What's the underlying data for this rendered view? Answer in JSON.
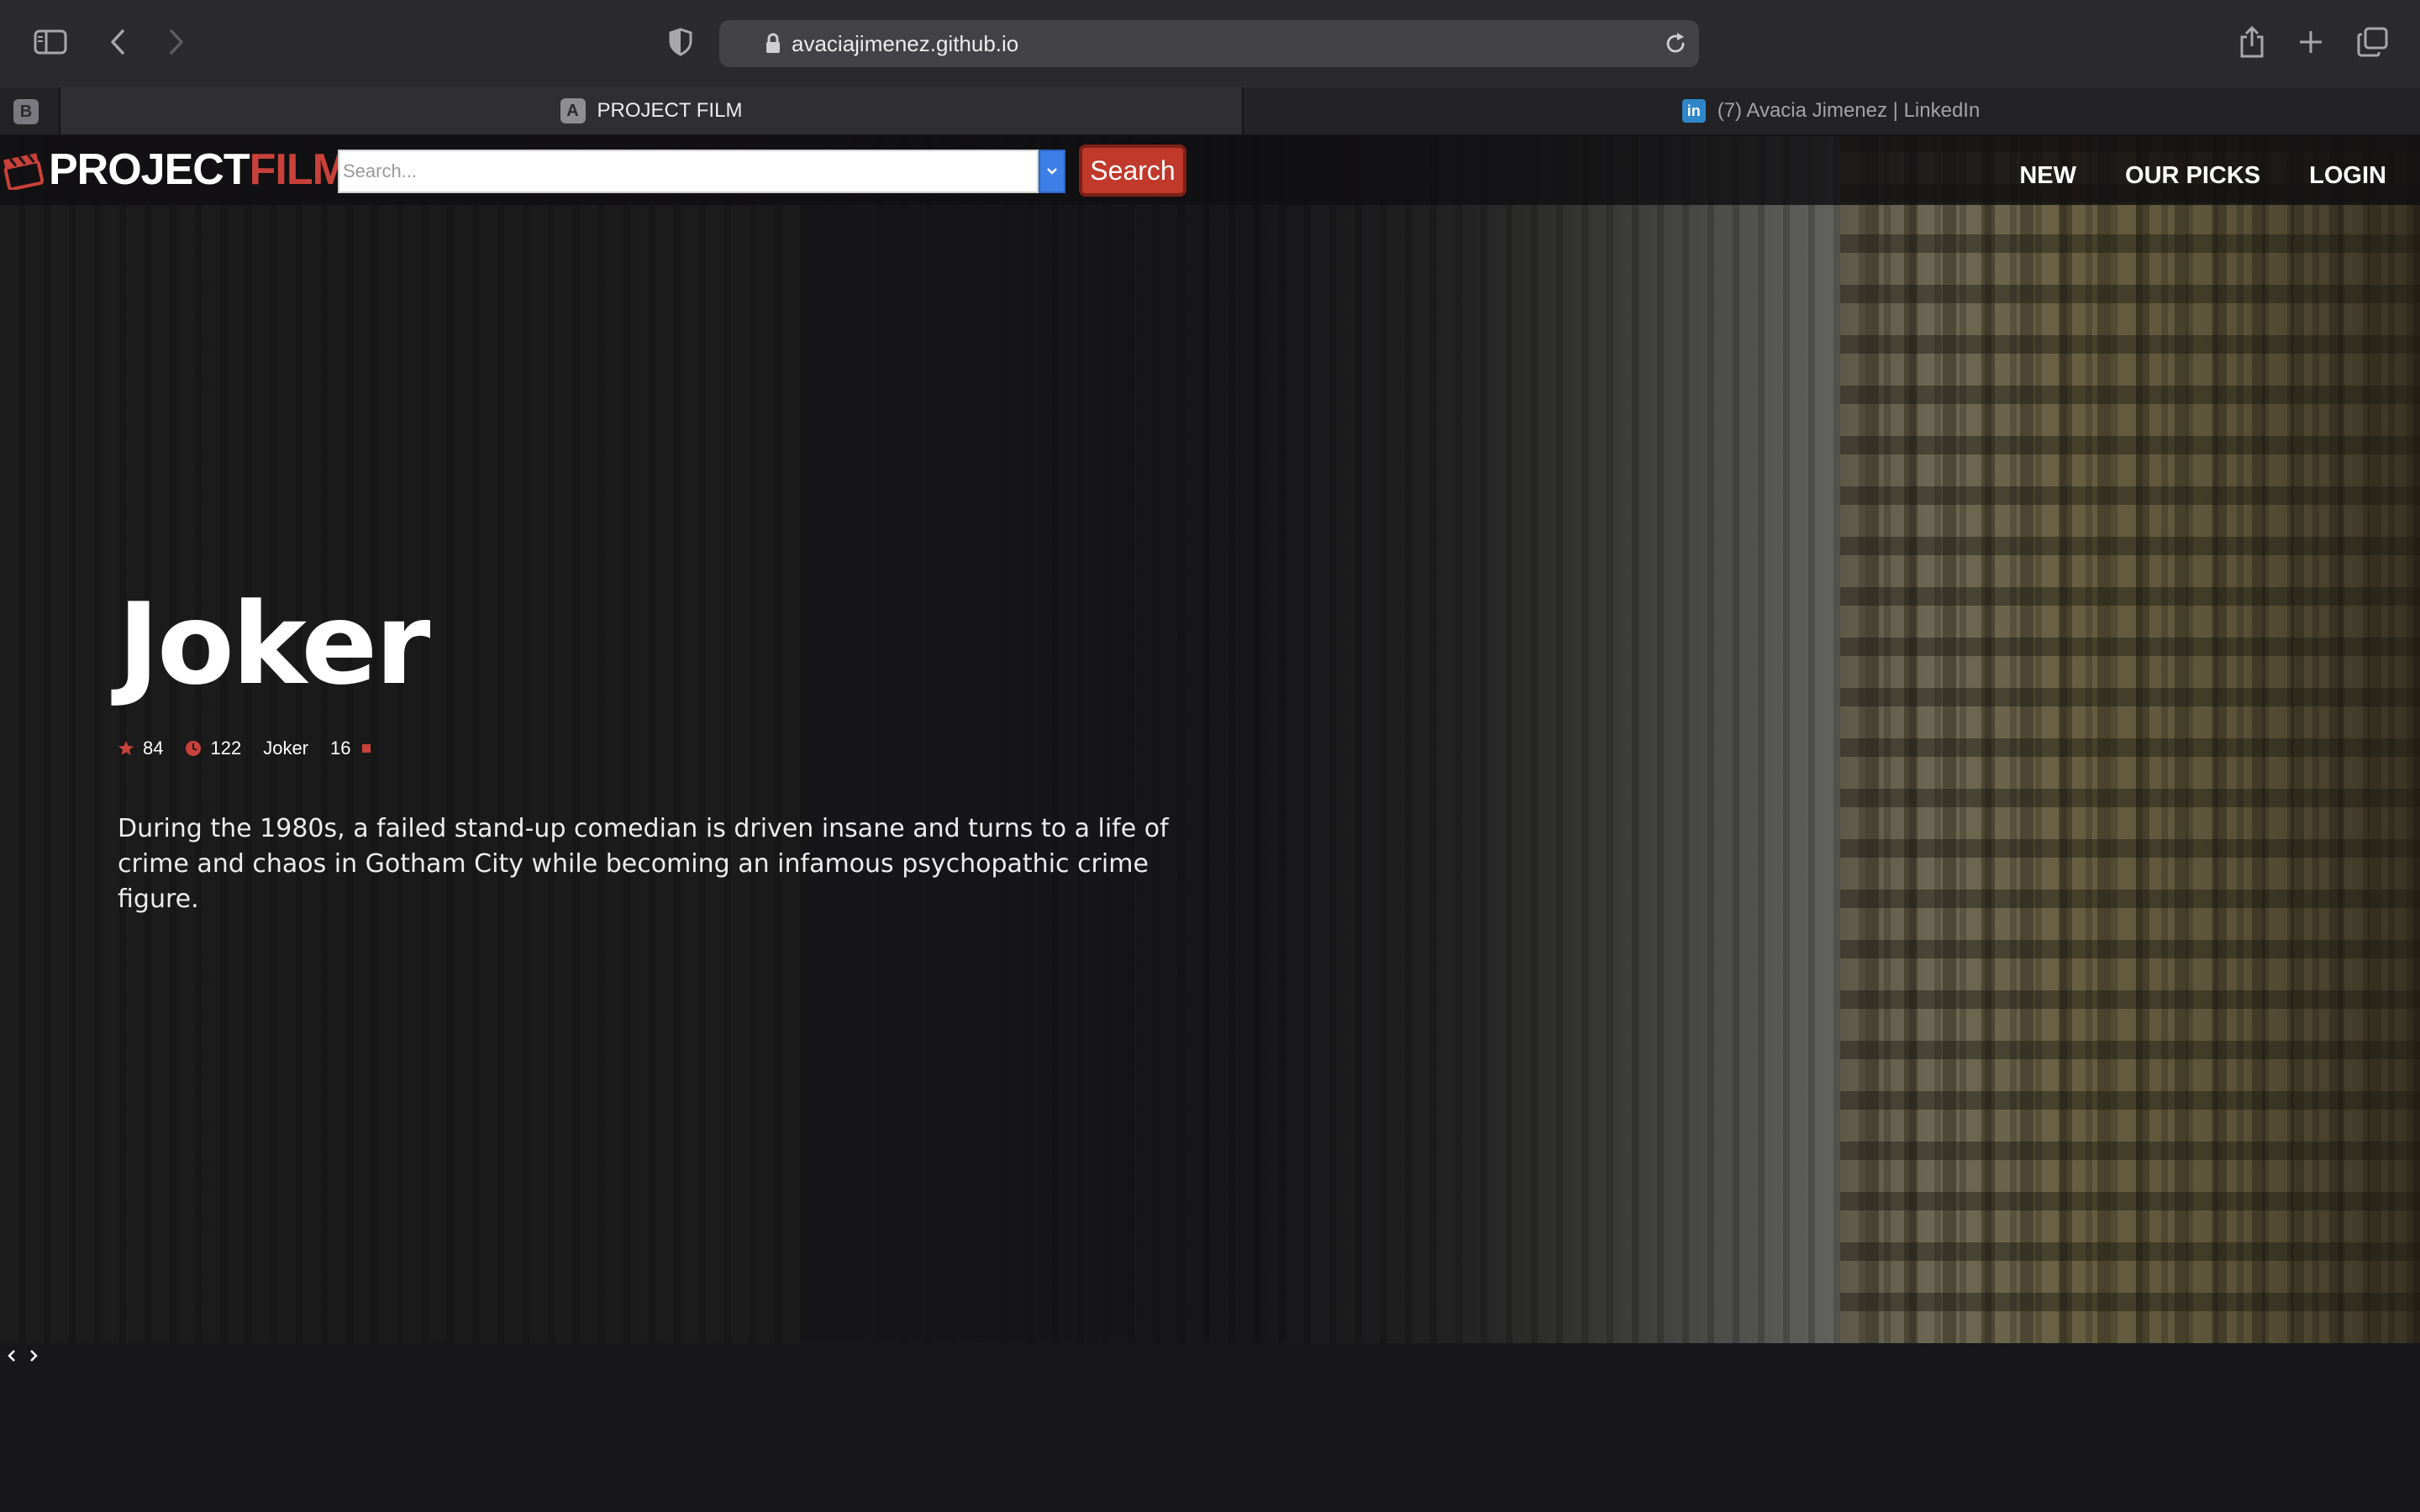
{
  "browser": {
    "url": "avaciajimenez.github.io",
    "pinned_tab_letter": "B",
    "tabs": [
      {
        "favicon_letter": "A",
        "title": "PROJECT FILM",
        "active": true
      },
      {
        "favicon_letter": "in",
        "title": "(7) Avacia Jimenez | LinkedIn",
        "active": false
      }
    ]
  },
  "site": {
    "logo": {
      "part1": "PROJECT",
      "part2": "FILM"
    },
    "search": {
      "placeholder": "Search...",
      "button_label": "Search"
    },
    "nav": [
      "NEW",
      "OUR PICKS",
      "LOGIN"
    ]
  },
  "hero": {
    "title": "Joker",
    "rating": "84",
    "runtime": "122",
    "tagline": "Joker",
    "age": "16",
    "overview": "During the 1980s, a failed stand-up comedian is driven insane and turns to a life of crime and chaos in Gotham City while becoming an infamous psychopathic crime figure."
  },
  "colors": {
    "accent": "#c8413a",
    "background": "#18171a",
    "select_blue": "#3c7fe6"
  },
  "icons": [
    "sidebar-icon",
    "back-icon",
    "forward-icon",
    "shield-icon",
    "lock-icon",
    "reload-icon",
    "share-icon",
    "new-tab-icon",
    "tabs-overview-icon",
    "clapperboard-icon",
    "star-icon",
    "clock-icon",
    "chevron-down-icon",
    "chevron-left-icon",
    "chevron-right-icon"
  ]
}
